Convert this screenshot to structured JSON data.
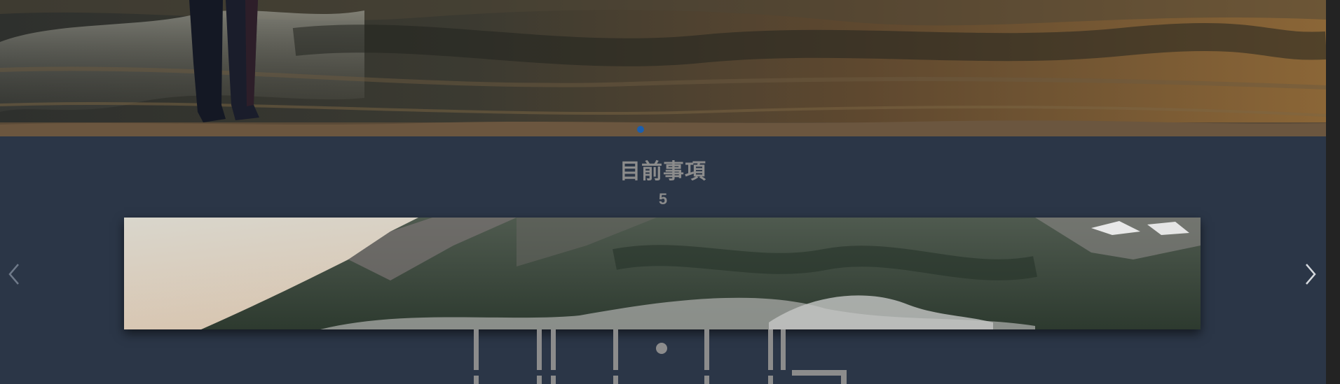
{
  "section": {
    "title": "目前事項",
    "count": "5"
  },
  "carousel": {
    "prev_icon": "chevron-left-icon",
    "next_icon": "chevron-right-icon",
    "active_dot_color": "#1b5fae"
  },
  "colors": {
    "background": "#2b3647",
    "heading_text": "#8c8c8c",
    "scrollbar": "#232323"
  }
}
